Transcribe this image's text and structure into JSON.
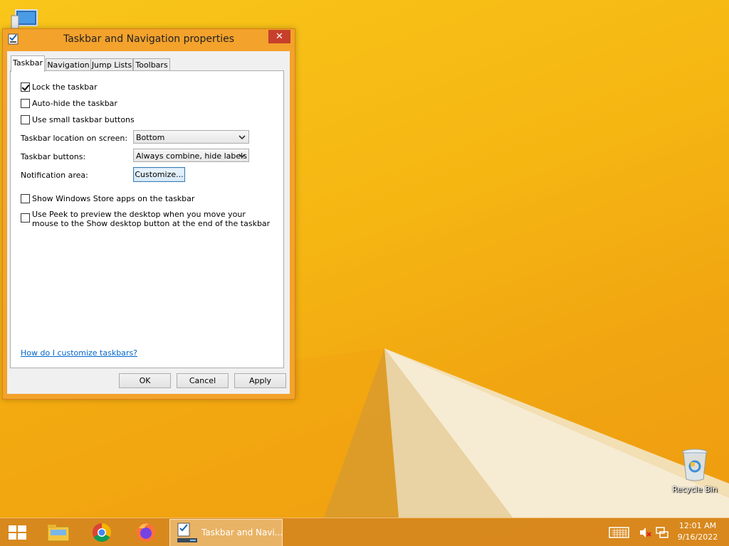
{
  "dialog": {
    "title": "Taskbar and Navigation properties",
    "close_symbol": "✕",
    "tabs": [
      "Taskbar",
      "Navigation",
      "Jump Lists",
      "Toolbars"
    ],
    "active_tab": "Taskbar",
    "options": {
      "lock_taskbar": {
        "label": "Lock the taskbar",
        "checked": true
      },
      "auto_hide": {
        "label": "Auto-hide the taskbar",
        "checked": false
      },
      "small_buttons": {
        "label": "Use small taskbar buttons",
        "checked": false
      },
      "store_apps": {
        "label": "Show Windows Store apps on the taskbar",
        "checked": false
      },
      "peek": {
        "label": "Use Peek to preview the desktop when you move your mouse to the Show desktop button at the end of the taskbar",
        "checked": false
      }
    },
    "location_label": "Taskbar location on screen:",
    "location_value": "Bottom",
    "buttons_label": "Taskbar buttons:",
    "buttons_value": "Always combine, hide labels",
    "notification_label": "Notification area:",
    "customize_button": "Customize...",
    "help_link": "How do I customize taskbars?",
    "ok_button": "OK",
    "cancel_button": "Cancel",
    "apply_button": "Apply"
  },
  "desktop": {
    "recycle_bin_label": "Recycle Bin"
  },
  "taskbar": {
    "active_window_label": "Taskbar and Navi...",
    "clock_time": "12:01 AM",
    "clock_date": "9/16/2022",
    "pinned_icons": [
      "file-explorer-icon",
      "chrome-icon",
      "firefox-icon"
    ]
  },
  "colors": {
    "wallpaper": "#f5b512",
    "dialog_frame": "#f3a22c",
    "close_button": "#c7402b",
    "link": "#0066cc"
  }
}
